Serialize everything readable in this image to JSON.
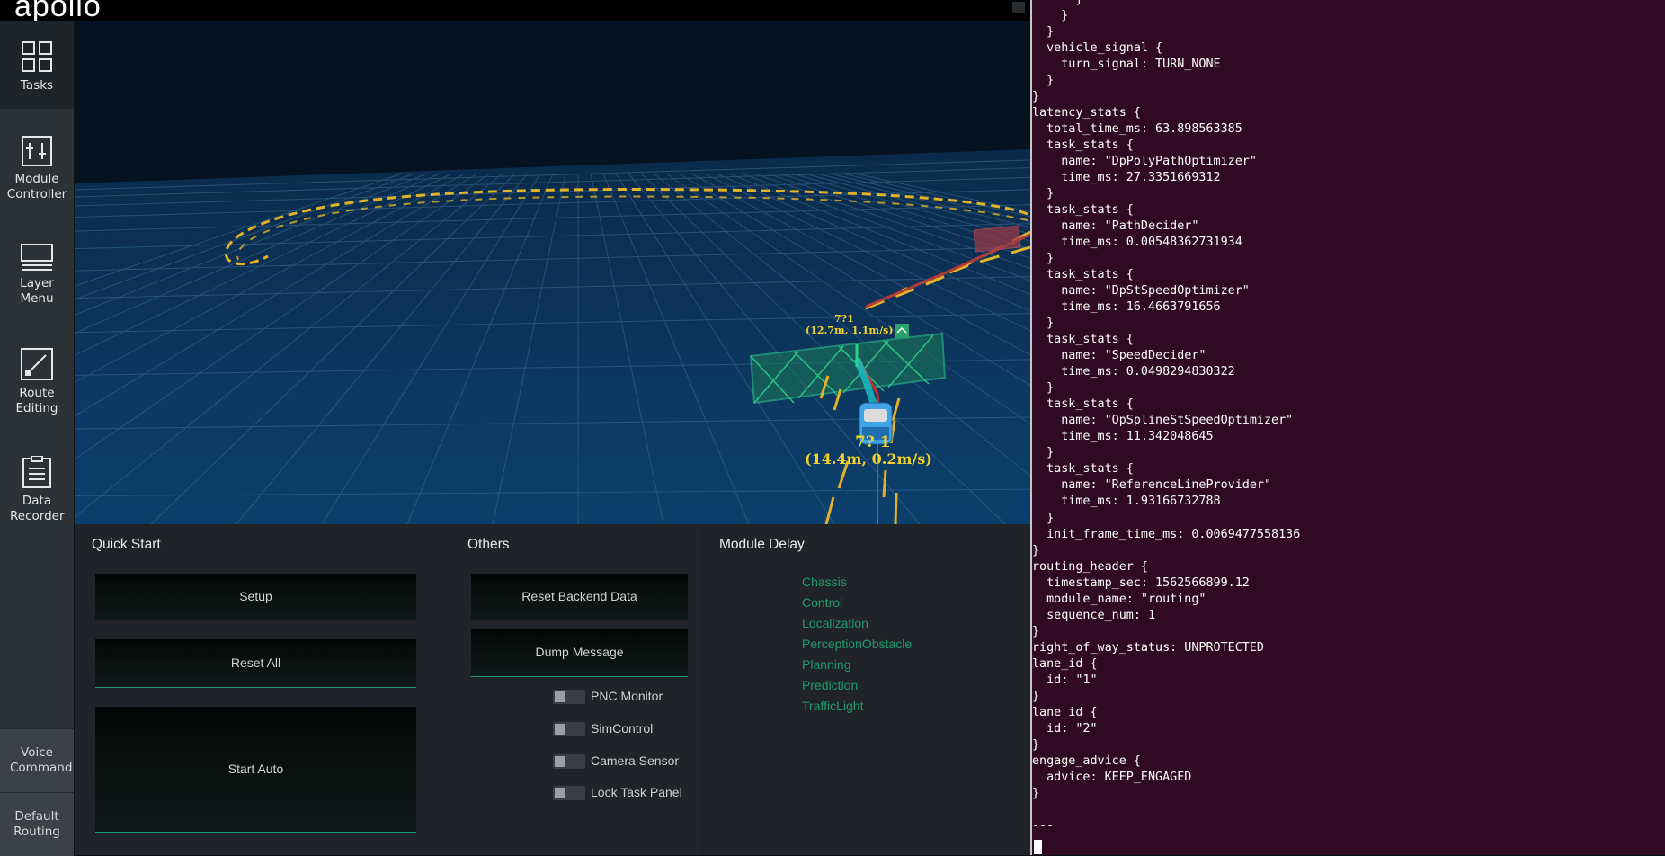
{
  "app": {
    "logo": "apollo"
  },
  "sidebar": {
    "items": [
      {
        "label": "Tasks"
      },
      {
        "label": "Module Controller"
      },
      {
        "label": "Layer Menu"
      },
      {
        "label": "Route Editing"
      },
      {
        "label": "Data Recorder"
      }
    ],
    "bottom": [
      {
        "label": "Voice Command"
      },
      {
        "label": "Default Routing"
      }
    ]
  },
  "scene": {
    "obstacle_label_1": "7?1",
    "obstacle_label_1_info": "(12.7m, 1.1m/s)",
    "ego_label": "7? 1",
    "ego_info": "(14.4m, 0.2m/s)"
  },
  "quick_start": {
    "title": "Quick Start",
    "setup": "Setup",
    "reset_all": "Reset All",
    "start_auto": "Start Auto"
  },
  "others": {
    "title": "Others",
    "reset_backend": "Reset Backend Data",
    "dump_message": "Dump Message",
    "toggles": [
      "PNC Monitor",
      "SimControl",
      "Camera Sensor",
      "Lock Task Panel"
    ]
  },
  "module_delay": {
    "title": "Module Delay",
    "items": [
      "Chassis",
      "Control",
      "Localization",
      "PerceptionObstacle",
      "Planning",
      "Prediction",
      "TrafficLight"
    ]
  },
  "terminal": {
    "lines": [
      "      }",
      "    }",
      "  }",
      "  vehicle_signal {",
      "    turn_signal: TURN_NONE",
      "  }",
      "}",
      "latency_stats {",
      "  total_time_ms: 63.898563385",
      "  task_stats {",
      "    name: \"DpPolyPathOptimizer\"",
      "    time_ms: 27.3351669312",
      "  }",
      "  task_stats {",
      "    name: \"PathDecider\"",
      "    time_ms: 0.00548362731934",
      "  }",
      "  task_stats {",
      "    name: \"DpStSpeedOptimizer\"",
      "    time_ms: 16.4663791656",
      "  }",
      "  task_stats {",
      "    name: \"SpeedDecider\"",
      "    time_ms: 0.0498294830322",
      "  }",
      "  task_stats {",
      "    name: \"QpSplineStSpeedOptimizer\"",
      "    time_ms: 11.342048645",
      "  }",
      "  task_stats {",
      "    name: \"ReferenceLineProvider\"",
      "    time_ms: 1.93166732788",
      "  }",
      "  init_frame_time_ms: 0.0069477558136",
      "}",
      "routing_header {",
      "  timestamp_sec: 1562566899.12",
      "  module_name: \"routing\"",
      "  sequence_num: 1",
      "}",
      "right_of_way_status: UNPROTECTED",
      "lane_id {",
      "  id: \"1\"",
      "}",
      "lane_id {",
      "  id: \"2\"",
      "}",
      "engage_advice {",
      "  advice: KEEP_ENGAGED",
      "}",
      "",
      "---"
    ]
  }
}
